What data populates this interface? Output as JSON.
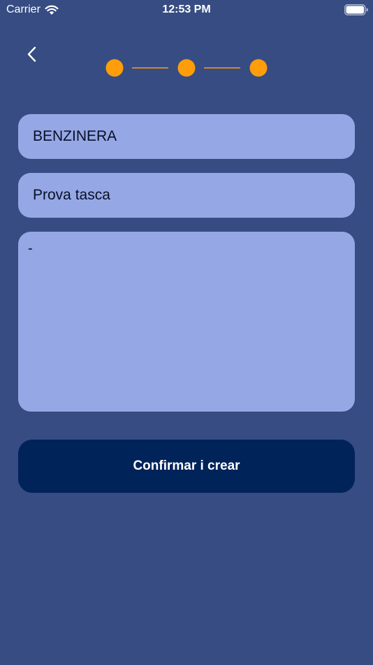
{
  "status_bar": {
    "carrier": "Carrier",
    "time": "12:53 PM"
  },
  "nav": {
    "back_icon": "chevron-left-icon"
  },
  "stepper": {
    "total_steps": 3,
    "current_step": 3,
    "active_color": "#ff9d0a"
  },
  "form": {
    "title_value": "BENZINERA",
    "name_value": "Prova tasca",
    "notes_value": "-"
  },
  "actions": {
    "confirm_label": "Confirmar i crear"
  },
  "colors": {
    "background": "#364c82",
    "field": "#95a8e5",
    "button": "#00235a",
    "accent": "#ff9d0a"
  }
}
